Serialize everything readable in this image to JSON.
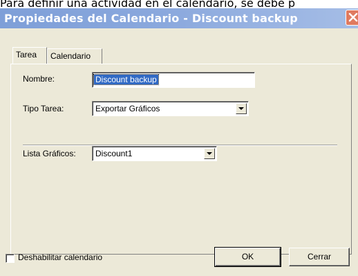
{
  "document": {
    "text_above": "Para definir una actividad en el calendario, se debe p"
  },
  "window": {
    "title": "Propiedades del Calendario - Discount backup"
  },
  "tabs": [
    {
      "label": "Tarea",
      "active": true
    },
    {
      "label": "Calendario",
      "active": false
    }
  ],
  "form": {
    "nombre_label": "Nombre:",
    "nombre_value": "Discount backup",
    "tipo_label": "Tipo Tarea:",
    "tipo_value": "Exportar Gráficos",
    "lista_label": "Lista Gráficos:",
    "lista_value": "Discount1"
  },
  "footer": {
    "checkbox_label": "Deshabilitar calendario",
    "checkbox_checked": false,
    "ok_label": "OK",
    "cerrar_label": "Cerrar"
  },
  "colors": {
    "titlebar": "#8aa8dd",
    "close_button": "#e07a5f",
    "dialog_face": "#ece9d8",
    "selection": "#316ac5"
  }
}
